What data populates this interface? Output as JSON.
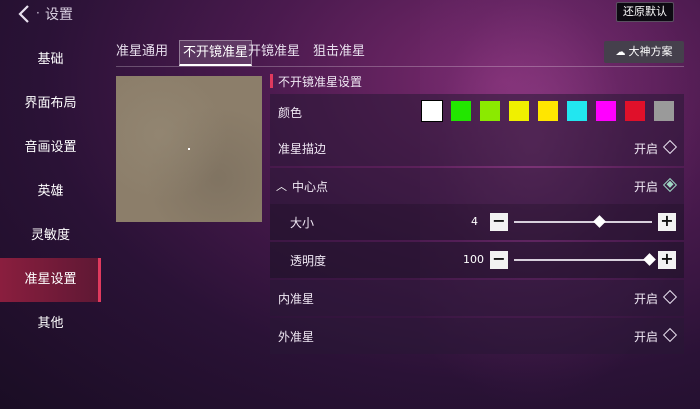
{
  "header": {
    "title": "设置",
    "separator": "·",
    "restore_label": "还原默认"
  },
  "sidebar": {
    "items": [
      {
        "label": "基础"
      },
      {
        "label": "界面布局"
      },
      {
        "label": "音画设置"
      },
      {
        "label": "英雄"
      },
      {
        "label": "灵敏度"
      },
      {
        "label": "准星设置",
        "active": true
      },
      {
        "label": "其他"
      }
    ]
  },
  "subtabs": {
    "items": [
      {
        "label": "准星通用"
      },
      {
        "label": "不开镜准星",
        "active": true
      },
      {
        "label": "开镜准星"
      },
      {
        "label": "狙击准星"
      }
    ],
    "master_label": "大神方案",
    "master_icon": "cloud-icon"
  },
  "panel": {
    "section_title": "不开镜准星设置",
    "color_label": "颜色",
    "swatches": [
      "#ffffff",
      "#22e600",
      "#8bea00",
      "#f0f000",
      "#ffe600",
      "#22e6f0",
      "#ff00ff",
      "#e0102a",
      "#9a9a9a"
    ],
    "selected_swatch": 0,
    "outline_label": "准星描边",
    "outline_state": "开启",
    "center_label": "中心点",
    "center_state": "开启",
    "size_label": "大小",
    "size_value": "4",
    "size_fraction": 0.62,
    "opacity_label": "透明度",
    "opacity_value": "100",
    "opacity_fraction": 0.98,
    "inner_label": "内准星",
    "inner_state": "开启",
    "outer_label": "外准星",
    "outer_state": "开启",
    "minus": "−",
    "plus": "+"
  }
}
